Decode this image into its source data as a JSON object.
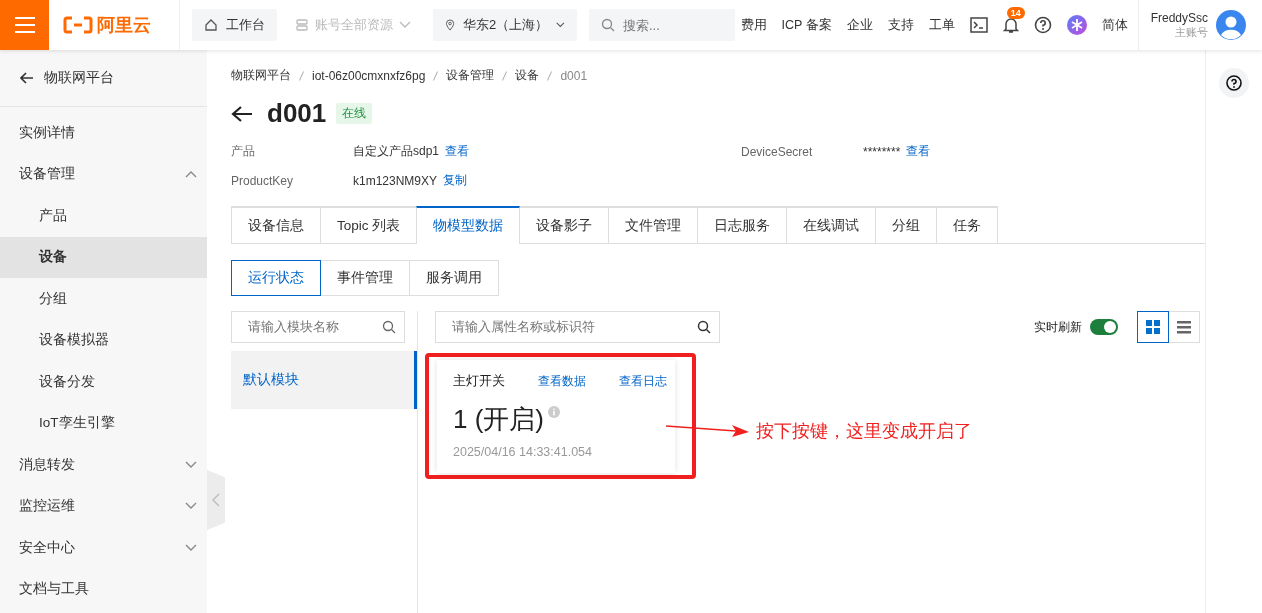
{
  "topbar": {
    "logo": "阿里云",
    "workbench": "工作台",
    "resources": {
      "label": "账号全部资源",
      "disabled": true
    },
    "region": "华东2（上海）",
    "search": {
      "placeholder": "搜索..."
    },
    "nav": [
      "费用",
      "ICP 备案",
      "企业",
      "支持",
      "工单"
    ],
    "notifications": "14",
    "language": "简体",
    "user": {
      "name": "FreddySsc",
      "role": "主账号"
    }
  },
  "sidebar": {
    "back": "物联网平台",
    "items": [
      {
        "label": "实例详情",
        "selected": false
      },
      {
        "label": "设备管理",
        "selected": false,
        "expanded": true,
        "children": [
          {
            "label": "产品",
            "selected": false
          },
          {
            "label": "设备",
            "selected": true
          },
          {
            "label": "分组",
            "selected": false
          },
          {
            "label": "设备模拟器",
            "selected": false
          },
          {
            "label": "设备分发",
            "selected": false
          },
          {
            "label": "IoT孪生引擎",
            "selected": false
          }
        ]
      },
      {
        "label": "消息转发",
        "selected": false,
        "expanded": false
      },
      {
        "label": "监控运维",
        "selected": false,
        "expanded": false
      },
      {
        "label": "安全中心",
        "selected": false,
        "expanded": false
      },
      {
        "label": "文档与工具",
        "selected": false
      }
    ]
  },
  "breadcrumb": [
    "物联网平台",
    "iot-06z00cmxnxfz6pg",
    "设备管理",
    "设备",
    "d001"
  ],
  "device": {
    "name": "d001",
    "status": "在线"
  },
  "info": [
    {
      "label": "产品",
      "value": "自定义产品sdp1",
      "link": "查看"
    },
    {
      "label": "DeviceSecret",
      "value": "********",
      "link": "查看"
    },
    {
      "label": "ProductKey",
      "value": "k1m123NM9XY",
      "link": "复制"
    }
  ],
  "tabs": [
    {
      "label": "设备信息",
      "selected": false
    },
    {
      "label": "Topic 列表",
      "selected": false
    },
    {
      "label": "物模型数据",
      "selected": true
    },
    {
      "label": "设备影子",
      "selected": false
    },
    {
      "label": "文件管理",
      "selected": false
    },
    {
      "label": "日志服务",
      "selected": false
    },
    {
      "label": "在线调试",
      "selected": false
    },
    {
      "label": "分组",
      "selected": false
    },
    {
      "label": "任务",
      "selected": false
    }
  ],
  "subtabs": [
    {
      "label": "运行状态",
      "selected": true
    },
    {
      "label": "事件管理",
      "selected": false
    },
    {
      "label": "服务调用",
      "selected": false
    }
  ],
  "module_search": {
    "placeholder": "请输入模块名称"
  },
  "modules": [
    {
      "label": "默认模块",
      "selected": true
    }
  ],
  "property_search": {
    "placeholder": "请输入属性名称或标识符"
  },
  "realtime_refresh": {
    "label": "实时刷新",
    "on": true
  },
  "view_modes": [
    {
      "kind": "grid",
      "selected": true
    },
    {
      "kind": "list",
      "selected": false
    }
  ],
  "properties": [
    {
      "name": "主灯开关",
      "links": [
        "查看数据",
        "查看日志"
      ],
      "value": "1 (开启)",
      "time": "2025/04/16 14:33:41.054",
      "highlighted": true
    }
  ],
  "annotation": "按下按键，这里变成开启了"
}
